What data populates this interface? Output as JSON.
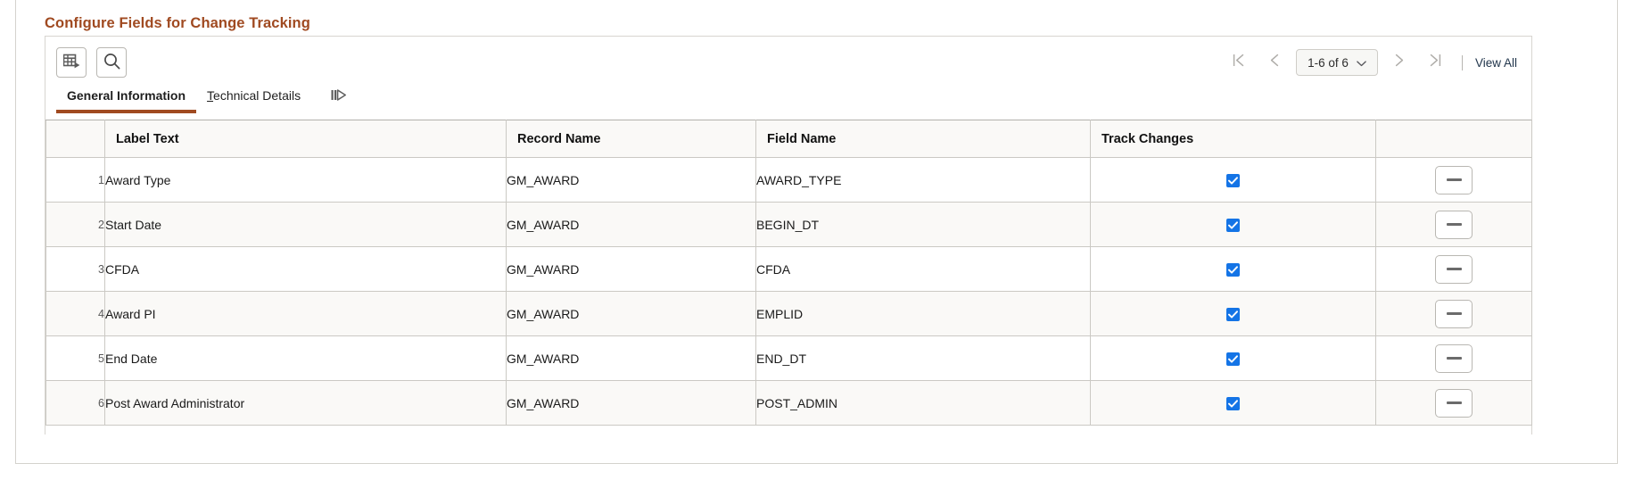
{
  "page": {
    "group_title": "Configure Fields for Change Tracking"
  },
  "toolbar": {
    "download_icon": "grid-download-icon",
    "download_title": "Download to Excel",
    "find_icon": "search-icon",
    "find_title": "Find"
  },
  "pager": {
    "first_icon": "first-page-icon",
    "prev_icon": "previous-page-icon",
    "range_label": "1-6 of 6",
    "dropdown_icon": "chevron-down-icon",
    "next_icon": "next-page-icon",
    "last_icon": "last-page-icon",
    "view_all_label": "View All"
  },
  "tabs": [
    {
      "label": "General Information",
      "accesskey": "",
      "active": true
    },
    {
      "label": "Technical Details",
      "accesskey": "T",
      "active": false
    }
  ],
  "tab_next_icon": "show-next-tab-icon",
  "table": {
    "headers": {
      "row_number": "",
      "label_text": "Label Text",
      "record_name": "Record Name",
      "field_name": "Field Name",
      "track_changes": "Track Changes",
      "actions": ""
    },
    "rows": [
      {
        "num": "1",
        "label_text": "Award Type",
        "record_name": "GM_AWARD",
        "field_name": "AWARD_TYPE",
        "track_changes": true,
        "delete_label": "—"
      },
      {
        "num": "2",
        "label_text": "Start Date",
        "record_name": "GM_AWARD",
        "field_name": "BEGIN_DT",
        "track_changes": true,
        "delete_label": "—"
      },
      {
        "num": "3",
        "label_text": "CFDA",
        "record_name": "GM_AWARD",
        "field_name": "CFDA",
        "track_changes": true,
        "delete_label": "—"
      },
      {
        "num": "4",
        "label_text": "Award PI",
        "record_name": "GM_AWARD",
        "field_name": "EMPLID",
        "track_changes": true,
        "delete_label": "—"
      },
      {
        "num": "5",
        "label_text": "End Date",
        "record_name": "GM_AWARD",
        "field_name": "END_DT",
        "track_changes": true,
        "delete_label": "—"
      },
      {
        "num": "6",
        "label_text": "Post Award Administrator",
        "record_name": "GM_AWARD",
        "field_name": "POST_ADMIN",
        "track_changes": true,
        "delete_label": "—"
      }
    ]
  },
  "colors": {
    "accent": "#a04a21",
    "checkbox": "#1474e6",
    "link": "#22364c",
    "border": "#cbc9c4",
    "row_alt": "#faf9f7"
  }
}
